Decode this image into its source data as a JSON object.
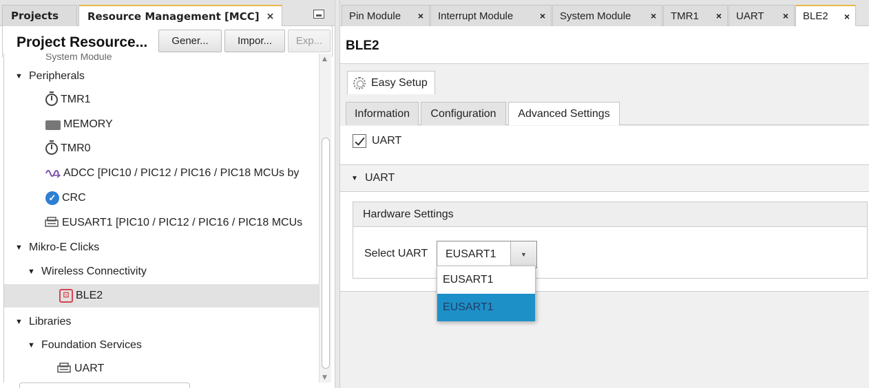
{
  "left_tabs": {
    "projects": "Projects",
    "resource_management": "Resource Management [MCC]",
    "close": "×"
  },
  "project_resources": {
    "title": "Project Resource...",
    "generate": "Gener...",
    "import": "Impor...",
    "export": "Exp..."
  },
  "tree": {
    "cut_item": "System Module",
    "peripherals": "Peripherals",
    "tmr1": "TMR1",
    "memory": "MEMORY",
    "tmr0": "TMR0",
    "adcc": "ADCC [PIC10 / PIC12 / PIC16 / PIC18 MCUs  by",
    "crc": "CRC",
    "eusart1": "EUSART1 [PIC10 / PIC12 / PIC16 / PIC18 MCUs",
    "mikroe": "Mikro-E Clicks",
    "wireless": "Wireless Connectivity",
    "ble2": "BLE2",
    "libraries": "Libraries",
    "foundation": "Foundation Services",
    "uart": "UART"
  },
  "right_tabs": [
    {
      "label": "Pin Module"
    },
    {
      "label": "Interrupt Module"
    },
    {
      "label": "System Module"
    },
    {
      "label": "TMR1"
    },
    {
      "label": "UART"
    },
    {
      "label": "BLE2"
    }
  ],
  "module": {
    "title": "BLE2",
    "easy_setup": "Easy Setup",
    "subtabs": [
      "Information",
      "Configuration",
      "Advanced Settings"
    ],
    "uart_checkbox": "UART",
    "uart_section": "UART",
    "hardware_settings": "Hardware Settings",
    "select_uart_label": "Select UART",
    "select_uart_value": "EUSART1",
    "dropdown_options": [
      "EUSART1",
      "EUSART1"
    ]
  },
  "colors": {
    "tab_accent": "#e6b84a",
    "selection_blue": "#1e90c8",
    "crc_blue": "#2f7fd1",
    "ble_red": "#d8434f"
  }
}
